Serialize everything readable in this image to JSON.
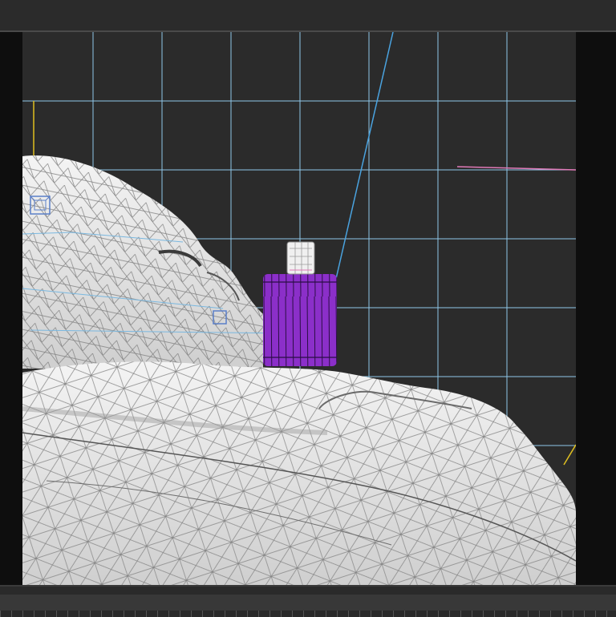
{
  "app": {
    "mode": "3d-viewport-wireframe",
    "grid_visible": true
  },
  "icons": {
    "camera_target": "cube-helper-icon",
    "light_helper": "light-helper-icon"
  },
  "colors": {
    "background": "#2b2b2b",
    "grid": "#8fc7e8",
    "mesh_fill": "#e3e3e3",
    "mesh_wire": "#7d7d7d",
    "selected_object": "#8b2fc9",
    "selected_wire": "#2a0d44",
    "bottle_cap": "#f0f0f0",
    "frame_accent": "#e0c020",
    "camera_line": "#4aa3e0",
    "pink_line": "#e07ab8"
  }
}
